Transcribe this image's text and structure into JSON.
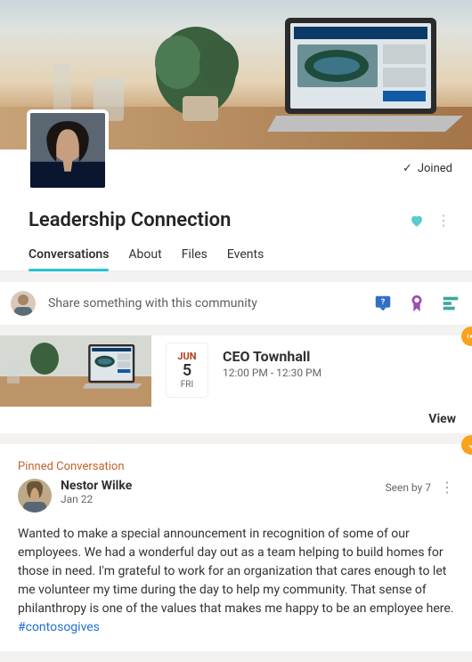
{
  "hero": {
    "joined_label": "Joined"
  },
  "header": {
    "title": "Leadership Connection",
    "tabs": {
      "0": {
        "label": "Conversations"
      },
      "1": {
        "label": "About"
      },
      "2": {
        "label": "Files"
      },
      "3": {
        "label": "Events"
      }
    }
  },
  "compose": {
    "placeholder": "Share something with this community"
  },
  "event": {
    "month": "JUN",
    "day": "5",
    "weekday": "FRI",
    "title": "CEO Townhall",
    "time": "12:00 PM - 12:30 PM",
    "view_label": "View"
  },
  "post": {
    "pinned_label": "Pinned Conversation",
    "author": "Nestor Wilke",
    "date": "Jan 22",
    "seen": "Seen by 7",
    "body": "Wanted to make a special announcement in recognition of some of our employees. We had a wonderful day out as a team helping to build homes for those in need. I'm grateful to work for an organization that cares enough to let me volunteer my time during the day to help my community. That sense of philanthropy is one of the values that makes me happy to be an employee here. ",
    "hashtag": "#contosogives"
  }
}
